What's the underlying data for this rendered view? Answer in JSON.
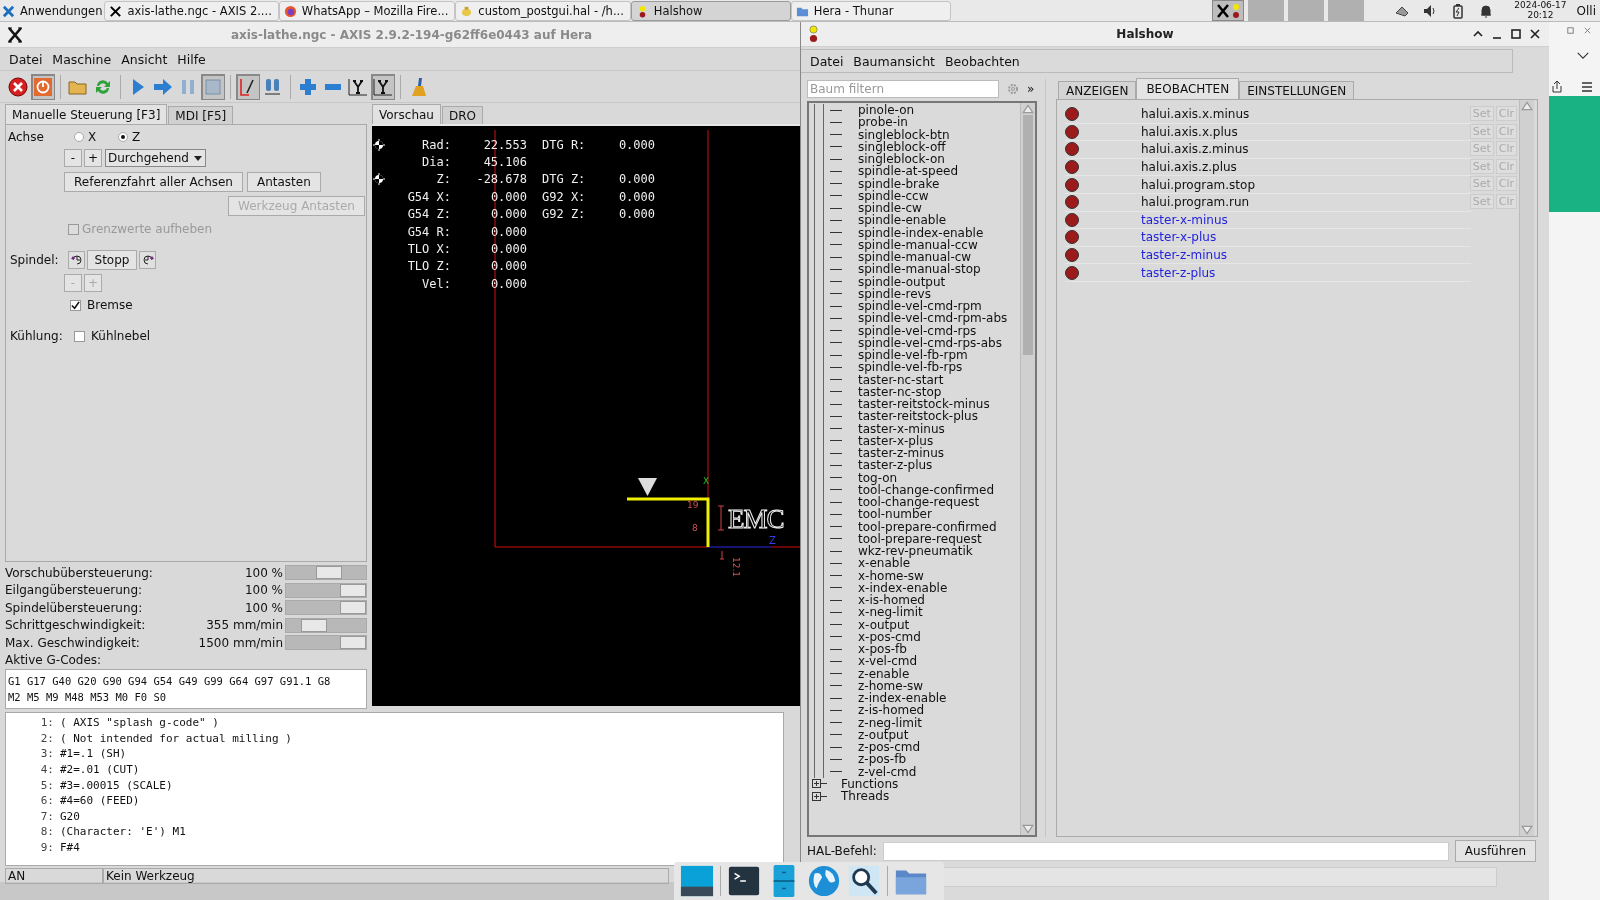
{
  "taskbar": {
    "tasks": [
      {
        "label": "Anwendungen",
        "kind": "menu",
        "selected": false
      },
      {
        "label": "axis-lathe.ngc - AXIS 2....",
        "kind": "axis",
        "selected": false
      },
      {
        "label": "WhatsApp – Mozilla Fire...",
        "kind": "firefox",
        "selected": false
      },
      {
        "label": "custom_postgui.hal - /h...",
        "kind": "editor",
        "selected": false
      },
      {
        "label": "Halshow",
        "kind": "halshow",
        "selected": true
      },
      {
        "label": "Hera - Thunar",
        "kind": "folder",
        "selected": false
      }
    ],
    "date": "2024-06-17",
    "time": "20:12",
    "user": "Olli"
  },
  "axis": {
    "title": "axis-lathe.ngc - AXIS 2.9.2-194-g62ff6e0443 auf Hera",
    "menu": [
      "Datei",
      "Maschine",
      "Ansicht",
      "Hilfe"
    ],
    "toolbar": [
      [
        {
          "kind": "estop",
          "pressed": false
        },
        {
          "kind": "power",
          "pressed": true
        }
      ],
      [
        {
          "kind": "open",
          "pressed": false
        },
        {
          "kind": "reload",
          "pressed": false
        }
      ],
      [
        {
          "kind": "run",
          "pressed": false
        },
        {
          "kind": "step",
          "pressed": false
        },
        {
          "kind": "pause",
          "pressed": false
        },
        {
          "kind": "stop",
          "pressed": true
        }
      ],
      [
        {
          "kind": "blockdelete",
          "pressed": true
        },
        {
          "kind": "optstop",
          "pressed": false
        }
      ],
      [
        {
          "kind": "zoomin",
          "pressed": false
        },
        {
          "kind": "zoomout",
          "pressed": false
        },
        {
          "kind": "viewy",
          "pressed": false
        },
        {
          "kind": "viewy",
          "pressed": true
        }
      ],
      [
        {
          "kind": "clear",
          "pressed": false
        }
      ]
    ],
    "tabs": [
      {
        "label": "Manuelle Steuerung [F3]",
        "selected": true
      },
      {
        "label": "MDI [F5]",
        "selected": false
      }
    ],
    "axis_label": "Achse",
    "axes": [
      {
        "label": "X",
        "selected": false
      },
      {
        "label": "Z",
        "selected": true
      }
    ],
    "jog": {
      "minus": "-",
      "plus": "+",
      "mode": "Durchgehend"
    },
    "home_button": "Referenzfahrt aller Achsen",
    "probe_button": "Antasten",
    "tool_probe": {
      "label": "Werkzeug Antasten",
      "disabled": true
    },
    "override_limits": {
      "label": "Grenzwerte aufheben",
      "checked": false,
      "disabled": true
    },
    "spindle": {
      "label": "Spindel:",
      "stop": "Stopp",
      "minus": "-",
      "plus": "+",
      "speed_disabled": true,
      "brake": {
        "label": "Bremse",
        "checked": true
      }
    },
    "coolant": {
      "label": "Kühlung:",
      "mist": {
        "label": "Kühlnebel",
        "checked": false
      }
    },
    "sliders": [
      {
        "label": "Vorschubübersteuerung:",
        "reading": "100 %",
        "level": 0.55
      },
      {
        "label": "Eilgangübersteuerung:",
        "reading": "100 %",
        "level": 1
      },
      {
        "label": "Spindelübersteuerung:",
        "reading": "100 %",
        "level": 1
      },
      {
        "label": "Schrittgeschwindigkeit:",
        "reading": "355 mm/min",
        "level": 0.28
      },
      {
        "label": "Max. Geschwindigkeit:",
        "reading": "1500 mm/min",
        "level": 1
      }
    ],
    "gcodes_label": "Aktive G-Codes:",
    "gcodes": [
      "G1 G17 G40 G20 G90 G94 G54 G49 G99 G64 G97 G91.1 G8",
      "M2 M5 M9 M48 M53 M0 F0 S0"
    ],
    "preview_tabs": [
      {
        "label": "Vorschau",
        "selected": true
      },
      {
        "label": "DRO",
        "selected": false
      }
    ],
    "dro": [
      {
        "cells": [
          "Rad:",
          "22.553",
          "DTG R:",
          "0.000"
        ],
        "homed": true
      },
      {
        "cells": [
          "Dia:",
          "45.106"
        ],
        "homed": false
      },
      {
        "cells": [
          "Z:",
          "-28.678",
          "DTG Z:",
          "0.000"
        ],
        "homed": true
      },
      {
        "cells": [
          "G54 X:",
          "0.000",
          "G92 X:",
          "0.000"
        ],
        "homed": false
      },
      {
        "cells": [
          "G54 Z:",
          "0.000",
          "G92 Z:",
          "0.000"
        ],
        "homed": false
      },
      {
        "cells": [
          "G54 R:",
          "0.000"
        ],
        "homed": false
      },
      {
        "cells": [
          "TLO X:",
          "0.000"
        ],
        "homed": false
      },
      {
        "cells": [
          "TLO Z:",
          "0.000"
        ],
        "homed": false
      },
      {
        "cells": [
          "Vel:",
          "0.000"
        ],
        "homed": false
      }
    ],
    "preview": {
      "dims": [
        "19",
        "8",
        "12.1"
      ],
      "axis_labels": [
        "X",
        "Z"
      ],
      "logo_text": "EMC"
    },
    "code": [
      {
        "num": "1:",
        "text": "( AXIS \"splash g-code\" )"
      },
      {
        "num": "2:",
        "text": "( Not intended for actual milling )"
      },
      {
        "num": "3:",
        "text": "#1=.1 (SH)"
      },
      {
        "num": "4:",
        "text": "#2=.01 (CUT)"
      },
      {
        "num": "5:",
        "text": "#3=.00015 (SCALE)"
      },
      {
        "num": "6:",
        "text": "#4=60 (FEED)"
      },
      {
        "num": "7:",
        "text": "G20"
      },
      {
        "num": "8:",
        "text": "(Character: 'E') M1"
      },
      {
        "num": "9:",
        "text": "F#4"
      }
    ],
    "status": [
      "AN",
      "Kein Werkzeug"
    ]
  },
  "halshow": {
    "title": "Halshow",
    "menu": [
      "Datei",
      "Baumansicht",
      "Beobachten"
    ],
    "filter_placeholder": "Baum filtern",
    "more": "»",
    "tree": {
      "continued_children": [
        "pinole-on",
        "probe-in",
        "singleblock-btn",
        "singleblock-off",
        "singleblock-on",
        "spindle-at-speed",
        "spindle-brake",
        "spindle-ccw",
        "spindle-cw",
        "spindle-enable",
        "spindle-index-enable",
        "spindle-manual-ccw",
        "spindle-manual-cw",
        "spindle-manual-stop",
        "spindle-output",
        "spindle-revs",
        "spindle-vel-cmd-rpm",
        "spindle-vel-cmd-rpm-abs",
        "spindle-vel-cmd-rps",
        "spindle-vel-cmd-rps-abs",
        "spindle-vel-fb-rpm",
        "spindle-vel-fb-rps",
        "taster-nc-start",
        "taster-nc-stop",
        "taster-reitstock-minus",
        "taster-reitstock-plus",
        "taster-x-minus",
        "taster-x-plus",
        "taster-z-minus",
        "taster-z-plus",
        "tog-on",
        "tool-change-confirmed",
        "tool-change-request",
        "tool-number",
        "tool-prepare-confirmed",
        "tool-prepare-request",
        "wkz-rev-pneumatik",
        "x-enable",
        "x-home-sw",
        "x-index-enable",
        "x-is-homed",
        "x-neg-limit",
        "x-output",
        "x-pos-cmd",
        "x-pos-fb",
        "x-vel-cmd",
        "z-enable",
        "z-home-sw",
        "z-index-enable",
        "z-is-homed",
        "z-neg-limit",
        "z-output",
        "z-pos-cmd",
        "z-pos-fb",
        "z-vel-cmd"
      ],
      "nodes": [
        {
          "label": "Functions",
          "expanded": false
        },
        {
          "label": "Threads",
          "expanded": false
        }
      ]
    },
    "tabs": [
      {
        "label": "ANZEIGEN",
        "selected": false
      },
      {
        "label": "BEOBACHTEN",
        "selected": true
      },
      {
        "label": "EINSTELLUNGEN",
        "selected": false
      }
    ],
    "watch": [
      {
        "name": "halui.axis.x.minus",
        "kind": "pin",
        "on": false,
        "buttons": [
          "Set",
          "Clr"
        ]
      },
      {
        "name": "halui.axis.x.plus",
        "kind": "pin",
        "on": false,
        "buttons": [
          "Set",
          "Clr"
        ]
      },
      {
        "name": "halui.axis.z.minus",
        "kind": "pin",
        "on": false,
        "buttons": [
          "Set",
          "Clr"
        ]
      },
      {
        "name": "halui.axis.z.plus",
        "kind": "pin",
        "on": false,
        "buttons": [
          "Set",
          "Clr"
        ]
      },
      {
        "name": "halui.program.stop",
        "kind": "pin",
        "on": false,
        "buttons": [
          "Set",
          "Clr"
        ]
      },
      {
        "name": "halui.program.run",
        "kind": "pin",
        "on": false,
        "buttons": [
          "Set",
          "Clr"
        ]
      },
      {
        "name": "taster-x-minus",
        "kind": "signal",
        "on": false
      },
      {
        "name": "taster-x-plus",
        "kind": "signal",
        "on": false
      },
      {
        "name": "taster-z-minus",
        "kind": "signal",
        "on": false
      },
      {
        "name": "taster-z-plus",
        "kind": "signal",
        "on": false
      }
    ],
    "hal_command": {
      "label": "HAL-Befehl:",
      "button": "Ausführen"
    }
  },
  "dock": [
    {
      "kind": "desktop"
    },
    {
      "kind": "terminal"
    },
    {
      "kind": "cabinet"
    },
    {
      "kind": "globe"
    },
    {
      "kind": "magnifier"
    },
    {
      "kind": "folder"
    }
  ]
}
